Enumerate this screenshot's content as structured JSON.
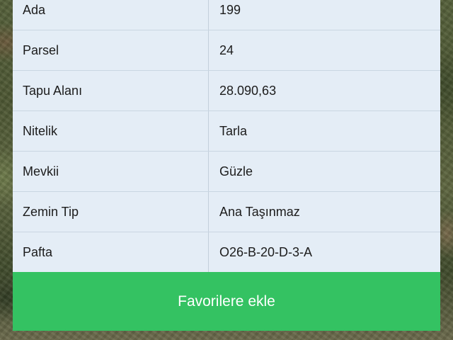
{
  "property_details": {
    "rows": [
      {
        "label": "Ada",
        "value": "199"
      },
      {
        "label": "Parsel",
        "value": "24"
      },
      {
        "label": "Tapu Alanı",
        "value": "28.090,63"
      },
      {
        "label": "Nitelik",
        "value": "Tarla"
      },
      {
        "label": "Mevkii",
        "value": "Güzle"
      },
      {
        "label": "Zemin Tip",
        "value": "Ana Taşınmaz"
      },
      {
        "label": "Pafta",
        "value": "O26-B-20-D-3-A"
      }
    ]
  },
  "actions": {
    "favorite_label": "Favorilere ekle"
  },
  "colors": {
    "table_background": "#e4edf6",
    "button_green": "#34c262",
    "button_text": "#ffffff"
  }
}
